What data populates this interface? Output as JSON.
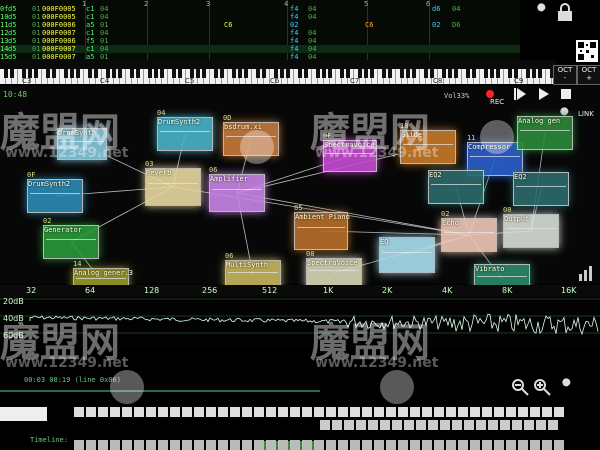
{
  "tracker": {
    "channel_headers": [
      "1",
      "2",
      "3",
      "4",
      "5",
      "6"
    ],
    "rows": [
      {
        "n": "0f",
        "a": "d5",
        "b": "01",
        "c": "000F0005",
        "d": "c1",
        "e": "04",
        "f": "",
        "g": "f4",
        "h": "04",
        "i": "",
        "j": "d6",
        "k": "04"
      },
      {
        "n": "10",
        "a": "d5",
        "b": "01",
        "c": "000F0005",
        "d": "c1",
        "e": "04",
        "f": "",
        "g": "f4",
        "h": "04",
        "i": "",
        "j": "",
        "k": ""
      },
      {
        "n": "11",
        "a": "d5",
        "b": "01",
        "c": "000F0006",
        "d": "a5",
        "e": "01",
        "f": "C6",
        "g": "02",
        "h": "",
        "i": "C6",
        "j": "02",
        "k": "D6",
        "l": "01"
      },
      {
        "n": "12",
        "a": "d5",
        "b": "01",
        "c": "000F0007",
        "d": "c1",
        "e": "04",
        "f": "",
        "g": "f4",
        "h": "04",
        "i": "",
        "j": "",
        "k": ""
      },
      {
        "n": "13",
        "a": "d5",
        "b": "01",
        "c": "000F0006",
        "d": "f5",
        "e": "01",
        "f": "",
        "g": "f4",
        "h": "04",
        "i": "",
        "j": "",
        "k": ""
      },
      {
        "n": "14",
        "a": "d5",
        "b": "01",
        "c": "000F0007",
        "d": "c1",
        "e": "04",
        "f": "",
        "g": "f4",
        "h": "04",
        "i": "",
        "j": "",
        "k": ""
      },
      {
        "n": "15",
        "a": "d5",
        "b": "01",
        "c": "000F0007",
        "d": "a5",
        "e": "01",
        "f": "",
        "g": "f4",
        "h": "04",
        "i": "",
        "j": "",
        "k": ""
      }
    ]
  },
  "top_icons": [
    "wrench-icon",
    "lock-icon",
    "qr-icon"
  ],
  "keyboard": {
    "octave_labels": [
      "C3",
      "C4",
      "C5",
      "C6",
      "C7",
      "C8",
      "C9"
    ],
    "oct_down": "OCT\n-",
    "oct_up": "OCT\n+"
  },
  "status": {
    "time": "10:48",
    "vol": "Vol33%",
    "rec": "REC",
    "link": "LINK"
  },
  "modules": [
    {
      "num": "",
      "name": "DrumSynth",
      "color": "#86c9e0"
    },
    {
      "num": "04",
      "name": "DrumSynth2",
      "color": "#4ab3c9"
    },
    {
      "num": "0D",
      "name": "bsdrum.xi",
      "color": "#c87a3a"
    },
    {
      "num": "0F",
      "name": "Spectravoice",
      "color": "#c74bd1"
    },
    {
      "num": "10",
      "name": "Glide",
      "color": "#c77a2a"
    },
    {
      "num": "11",
      "name": "Compressor",
      "color": "#2b5fd1"
    },
    {
      "num": "",
      "name": "Analog gen",
      "color": "#2b8a3a"
    },
    {
      "num": "0F",
      "name": "DrumSynth2",
      "color": "#2b8ab3"
    },
    {
      "num": "03",
      "name": "Reverb",
      "color": "#e8d9a0"
    },
    {
      "num": "06",
      "name": "Amplifier",
      "color": "#c785e6"
    },
    {
      "num": "",
      "name": "EQ2",
      "color": "#2b6b6b"
    },
    {
      "num": "",
      "name": "EQ2",
      "color": "#2b6b6b"
    },
    {
      "num": "02",
      "name": "Generator",
      "color": "#2b9a3a"
    },
    {
      "num": "05",
      "name": "Ambient Piano",
      "color": "#b8702a"
    },
    {
      "num": "02",
      "name": "Echo",
      "color": "#f0c8b8"
    },
    {
      "num": "00",
      "name": "Output",
      "color": "#d8e0d8"
    },
    {
      "num": "",
      "name": "EQ",
      "color": "#a8e0f0"
    },
    {
      "num": "06",
      "name": "MultiSynth",
      "color": "#c8b860"
    },
    {
      "num": "08",
      "name": "SpectraVoice",
      "color": "#d8d8b8"
    },
    {
      "num": "",
      "name": "Vibrato",
      "color": "#2b8a6a"
    },
    {
      "num": "14",
      "name": "Analog gener.3",
      "color": "#9a9a2a"
    }
  ],
  "spectrum": {
    "freqs": [
      "32",
      "64",
      "128",
      "256",
      "512",
      "1K",
      "2K",
      "4K",
      "8K",
      "16K"
    ],
    "db": [
      "20dB",
      "40dB",
      "60dB"
    ]
  },
  "bottom": {
    "timeline_status": "00:03 00:19 (line 0x00)",
    "timeline_label": "Timeline:",
    "tool_icons": [
      "zoom-out-icon",
      "zoom-in-icon",
      "wrench-icon"
    ]
  },
  "watermark": {
    "text": "魔盟网",
    "url": "www.12349.net"
  }
}
